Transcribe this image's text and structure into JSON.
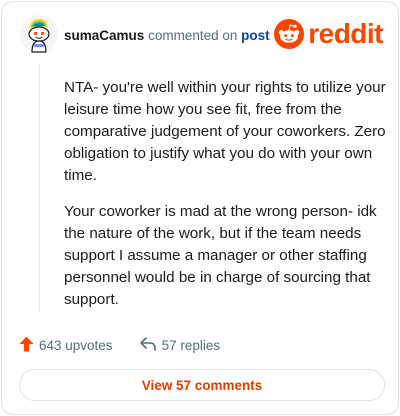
{
  "comment": {
    "username": "sumaCamus",
    "action_text": "commented on",
    "target_text": "post",
    "paragraphs": [
      "NTA- you're well within your rights to utilize your leisure time how you see fit, free from the comparative judgement of your coworkers. Zero obligation to justify what you do with your own time.",
      "Your coworker is mad at the wrong person- idk the nature of the work, but if the team needs support I assume a manager or other staffing personnel would be in charge of sourcing that support."
    ]
  },
  "brand": {
    "wordmark": "reddit",
    "color": "#ff4500"
  },
  "stats": {
    "upvotes": "643 upvotes",
    "replies": "57 replies"
  },
  "actions": {
    "view_comments": "View 57 comments"
  },
  "icons": {
    "avatar": "snoo-avatar-icon",
    "logo": "reddit-snoo-icon",
    "upvote": "upvote-arrow-icon",
    "reply": "reply-arrow-icon"
  }
}
